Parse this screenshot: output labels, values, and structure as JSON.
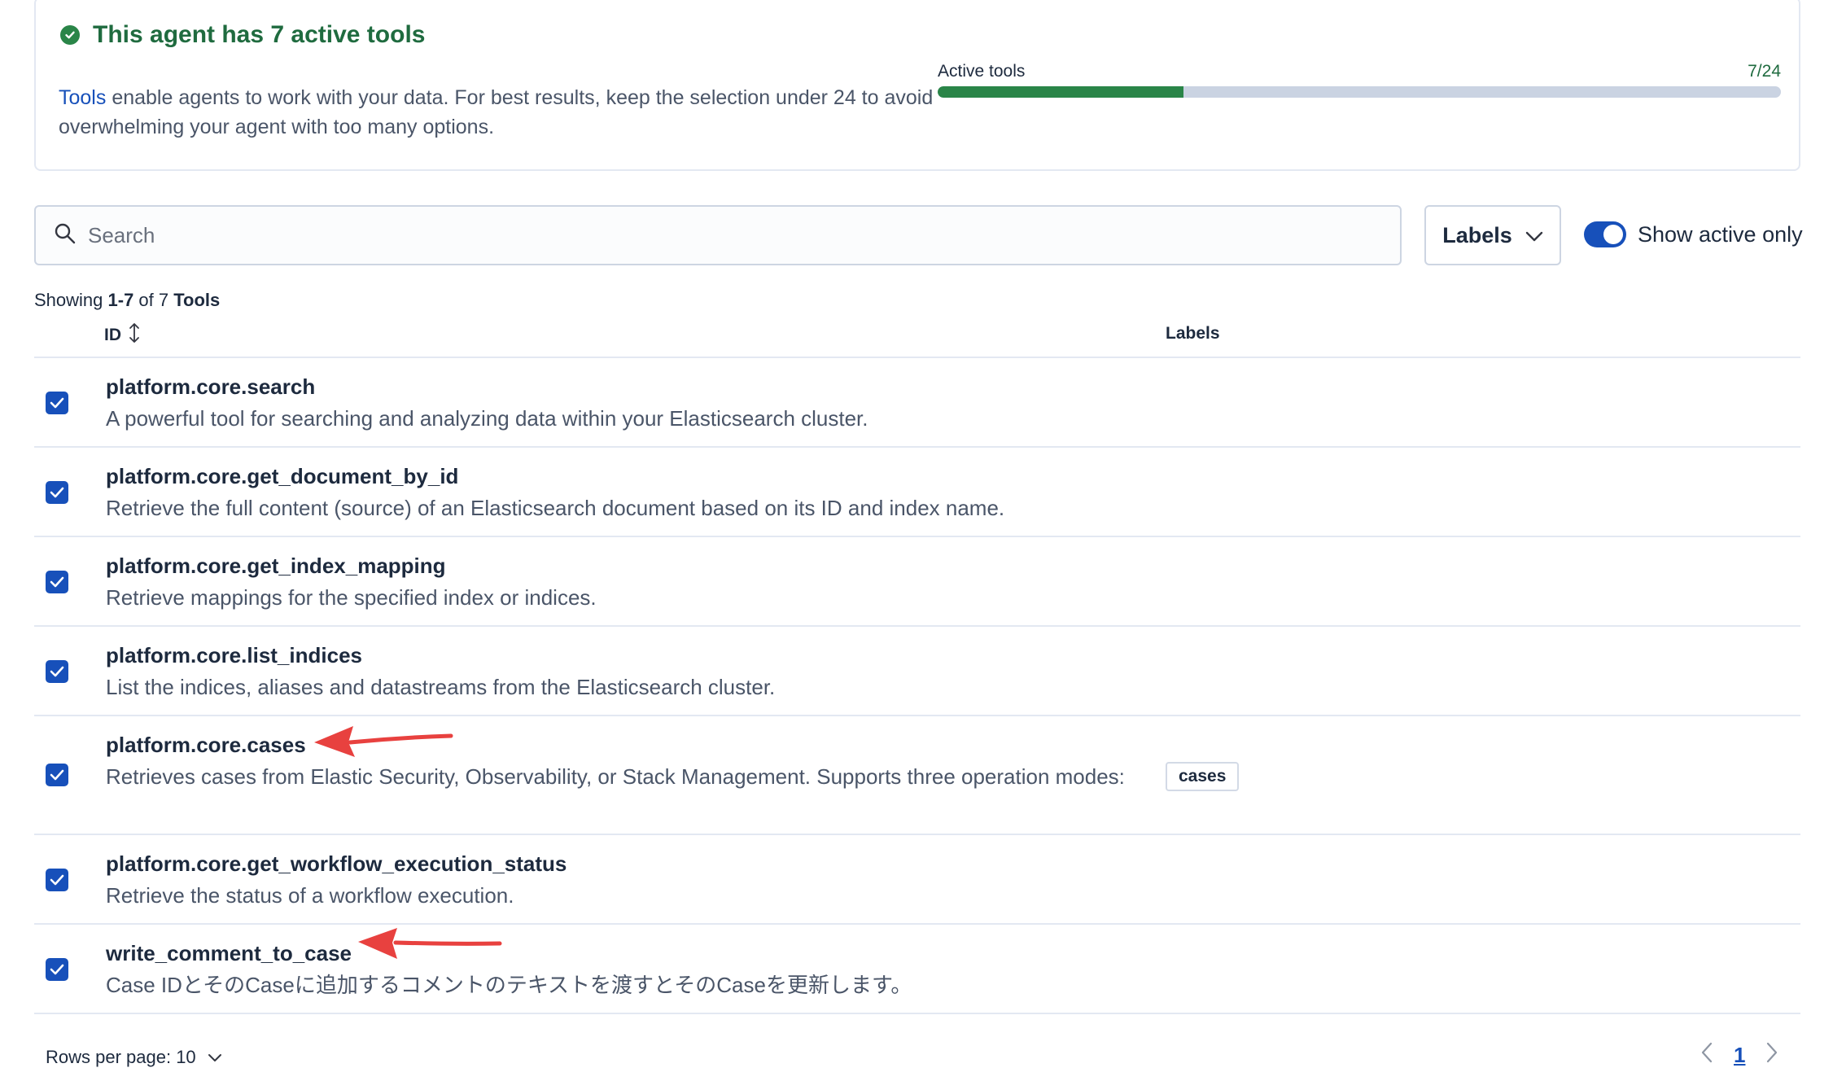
{
  "summary": {
    "title": "This agent has 7 active tools",
    "link_text": "Tools",
    "description": " enable agents to work with your data. For best results, keep the selection under 24 to avoid overwhelming your agent with too many options.",
    "progress_label": "Active tools",
    "progress_count": "7/24",
    "progress_fraction": 0.2917,
    "accent_color": "#2a8548"
  },
  "toolbar": {
    "search_placeholder": "Search",
    "search_value": "",
    "labels_button": "Labels",
    "toggle_label": "Show active only",
    "toggle_on": true
  },
  "showing": {
    "prefix": "Showing ",
    "range": "1-7",
    "middle": " of 7 ",
    "suffix": "Tools"
  },
  "table": {
    "columns": [
      "ID",
      "Labels"
    ],
    "rows": [
      {
        "id": "platform.core.search",
        "description": "A powerful tool for searching and analyzing data within your Elasticsearch cluster.",
        "label": "",
        "checked": true
      },
      {
        "id": "platform.core.get_document_by_id",
        "description": "Retrieve the full content (source) of an Elasticsearch document based on its ID and index name.",
        "label": "",
        "checked": true
      },
      {
        "id": "platform.core.get_index_mapping",
        "description": "Retrieve mappings for the specified index or indices.",
        "label": "",
        "checked": true
      },
      {
        "id": "platform.core.list_indices",
        "description": "List the indices, aliases and datastreams from the Elasticsearch cluster.",
        "label": "",
        "checked": true
      },
      {
        "id": "platform.core.cases",
        "description": "Retrieves cases from Elastic Security, Observability, or Stack Management. Supports three operation modes:",
        "label": "cases",
        "checked": true
      },
      {
        "id": "platform.core.get_workflow_execution_status",
        "description": "Retrieve the status of a workflow execution.",
        "label": "",
        "checked": true
      },
      {
        "id": "write_comment_to_case",
        "description": "Case IDとそのCaseに追加するコメントのテキストを渡すとそのCaseを更新します。",
        "label": "",
        "checked": true
      }
    ]
  },
  "footer": {
    "rows_per_page": "Rows per page: 10",
    "current_page": "1"
  },
  "icons": {
    "status": "check-circle-icon",
    "search": "search-icon",
    "dropdown": "chevron-down-icon",
    "sort": "sort-icon",
    "checkbox": "check-icon",
    "prev": "chevron-left-icon",
    "next": "chevron-right-icon",
    "annotation": "red-arrow-icon"
  },
  "colors": {
    "primary": "#1750ba",
    "success": "#2a8548",
    "annotation": "#e8413f"
  }
}
